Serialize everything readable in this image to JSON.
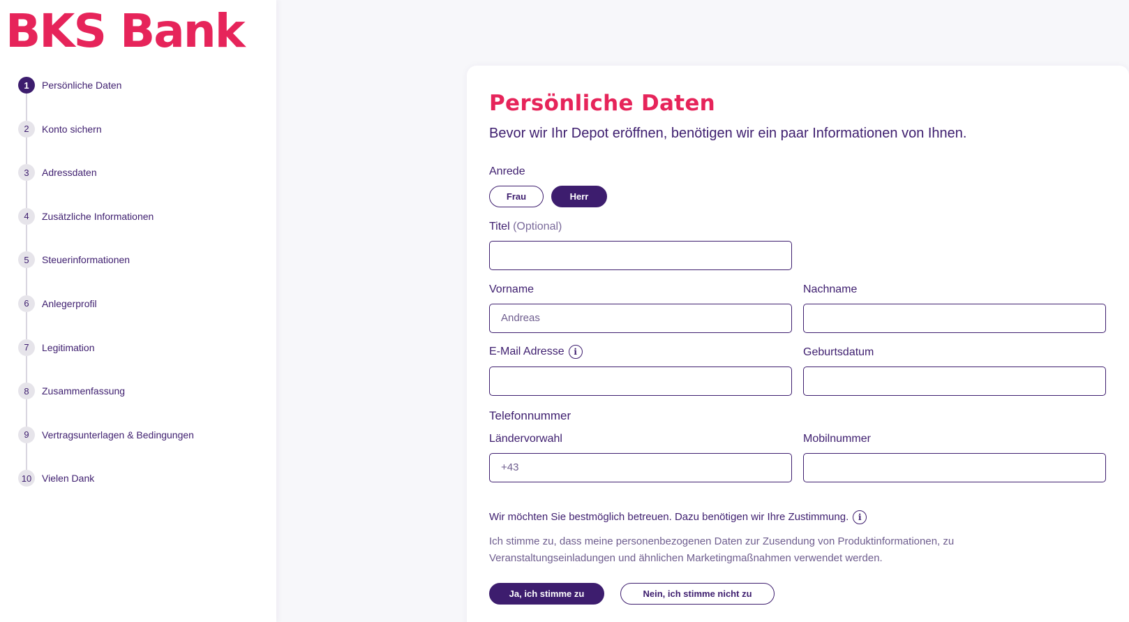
{
  "brand": {
    "logo_text": "BKS Bank",
    "accent": "#e6245a",
    "primary": "#3d1d6e"
  },
  "steps": [
    {
      "num": "1",
      "label": "Persönliche Daten",
      "active": true
    },
    {
      "num": "2",
      "label": "Konto sichern"
    },
    {
      "num": "3",
      "label": "Adressdaten"
    },
    {
      "num": "4",
      "label": "Zusätzliche Informationen"
    },
    {
      "num": "5",
      "label": "Steuerinformationen"
    },
    {
      "num": "6",
      "label": "Anlegerprofil"
    },
    {
      "num": "7",
      "label": "Legitimation"
    },
    {
      "num": "8",
      "label": "Zusammenfassung"
    },
    {
      "num": "9",
      "label": "Vertragsunterlagen & Bedingungen"
    },
    {
      "num": "10",
      "label": "Vielen Dank"
    }
  ],
  "form": {
    "title": "Persönliche Daten",
    "subtitle": "Bevor wir Ihr Depot eröffnen, benötigen wir ein paar Informationen von Ihnen.",
    "anrede": {
      "label": "Anrede",
      "options": [
        "Frau",
        "Herr"
      ],
      "selected": "Herr"
    },
    "titel": {
      "label": "Titel",
      "optional": "(Optional)",
      "value": ""
    },
    "vorname": {
      "label": "Vorname",
      "value": "Andreas"
    },
    "nachname": {
      "label": "Nachname",
      "value": ""
    },
    "email": {
      "label": "E-Mail Adresse",
      "value": ""
    },
    "geburtsdatum": {
      "label": "Geburtsdatum",
      "value": ""
    },
    "telefon": {
      "heading": "Telefonnummer",
      "vorwahl_label": "Ländervorwahl",
      "vorwahl_value": "+43",
      "mobil_label": "Mobilnummer",
      "mobil_value": ""
    },
    "consent": {
      "question": "Wir möchten Sie bestmöglich betreuen. Dazu benötigen wir Ihre Zustimmung.",
      "text": "Ich stimme zu, dass meine personenbezogenen Daten zur Zusendung von Produktinformationen, zu Veranstaltungseinladungen und ähnlichen Marketingmaßnahmen verwendet werden.",
      "accept_label": "Ja, ich stimme zu",
      "decline_label": "Nein, ich stimme nicht zu"
    }
  }
}
